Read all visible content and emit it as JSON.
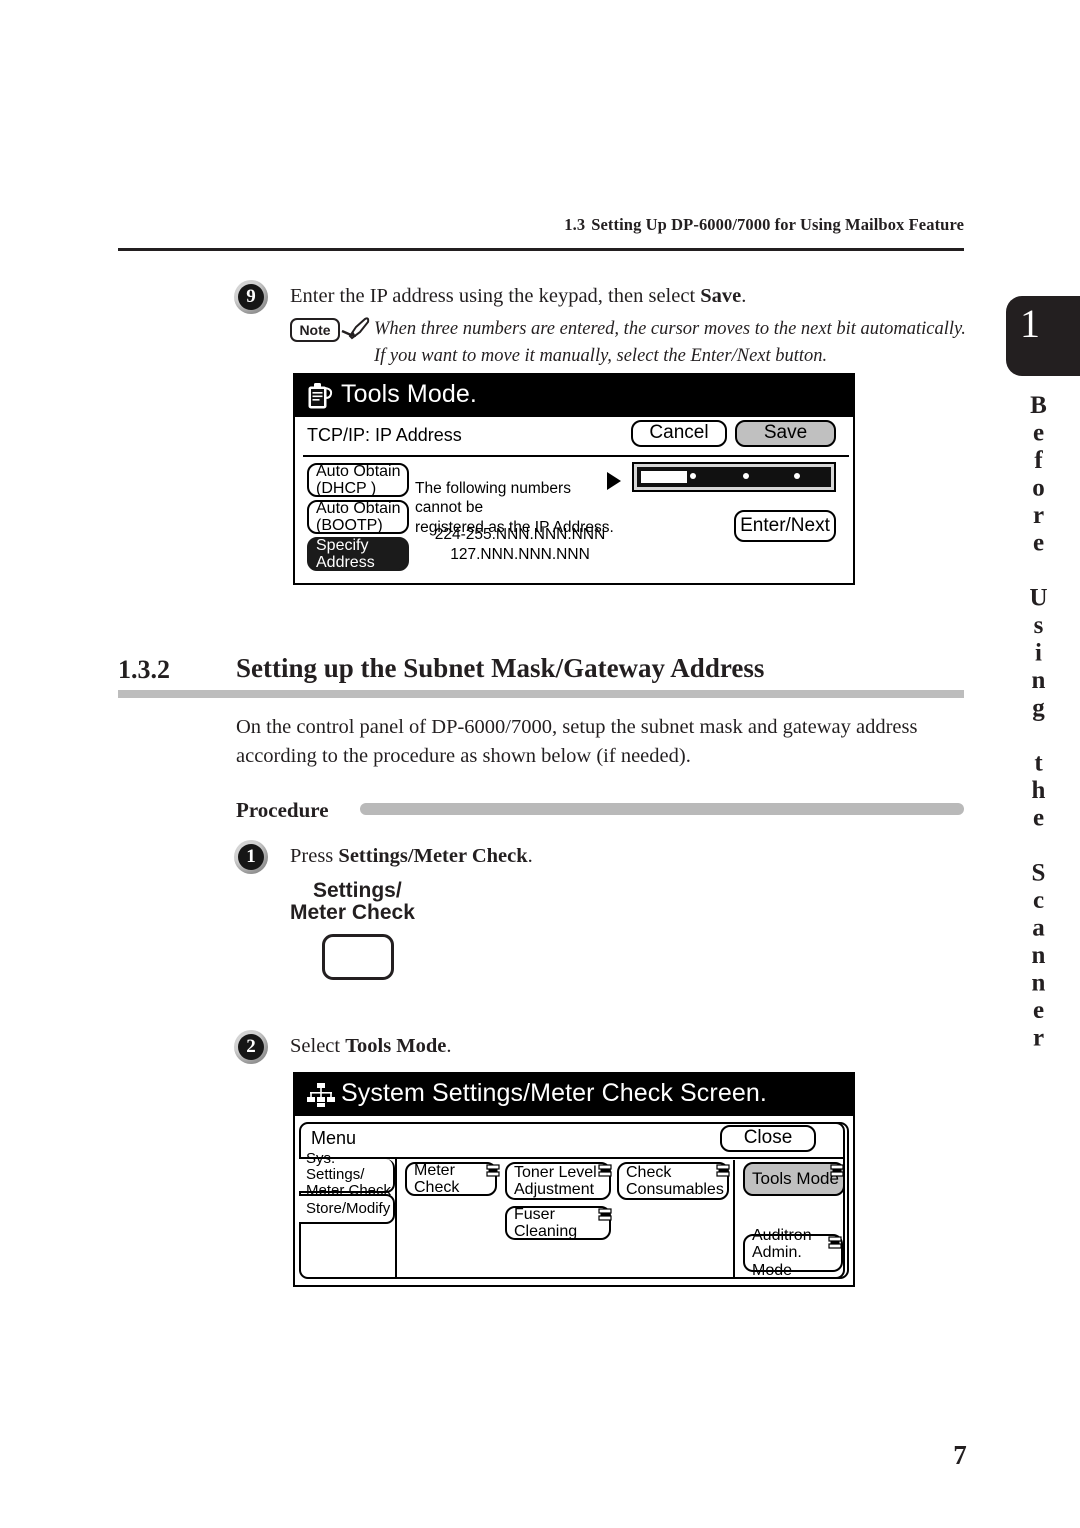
{
  "running_head": {
    "section": "1.3",
    "title": "Setting Up DP-6000/7000 for Using Mailbox Feature"
  },
  "thumb_tab": {
    "chapter_number": "1",
    "chapter_title": "Before Using the Scanner"
  },
  "step9": {
    "number": "9",
    "text_before": "Enter the IP address using the keypad, then select ",
    "bold": "Save",
    "text_after": "."
  },
  "note": {
    "badge": "Note",
    "line1": "When three numbers are entered, the cursor moves to the next bit automatically.",
    "line2": "If you want to move it manually, select the Enter/Next button."
  },
  "screen_tools_mode": {
    "title": "Tools Mode.",
    "title_icon": "tools-clipboard-icon",
    "subtitle": "TCP/IP: IP Address",
    "cancel_label": "Cancel",
    "save_label": "Save",
    "options": [
      {
        "line1": "Auto Obtain",
        "line2": "(DHCP    )",
        "selected": false
      },
      {
        "line1": "Auto Obtain",
        "line2": "(BOOTP)",
        "selected": false
      },
      {
        "line1": "Specify",
        "line2": "Address",
        "selected": true
      }
    ],
    "info_line1": "The following numbers cannot be",
    "info_line2": "registered as the IP Address.",
    "excluded1": "224-255.NNN.NNN.NNN",
    "excluded2": "127.NNN.NNN.NNN",
    "enter_next_label": "Enter/Next"
  },
  "section": {
    "number": "1.3.2",
    "title": "Setting up the Subnet Mask/Gateway Address",
    "body_line1": "On the control panel of DP-6000/7000, setup the subnet mask and gateway address",
    "body_line2": "according to the procedure as shown below (if needed).",
    "procedure_label": "Procedure"
  },
  "step1": {
    "number": "1",
    "text_before": "Press ",
    "bold": "Settings/Meter Check",
    "text_after": ".",
    "hw_label_line1": "Settings/",
    "hw_label_line2": "Meter Check"
  },
  "step2": {
    "number": "2",
    "text_before": "Select ",
    "bold": "Tools Mode",
    "text_after": "."
  },
  "screen_sys_settings": {
    "title": "System Settings/Meter Check Screen.",
    "title_icon": "hierarchy-icon",
    "menu_label": "Menu",
    "close_label": "Close",
    "left_tabs": [
      {
        "line1": "Sys. Settings/",
        "line2": "Meter Check",
        "active": true
      },
      {
        "line1": "Store/Modify",
        "line2": "",
        "active": false
      }
    ],
    "buttons": [
      {
        "line1": "Meter Check",
        "line2": "",
        "selected": false,
        "has_key": true
      },
      {
        "line1": "Toner Level",
        "line2": "Adjustment",
        "selected": false,
        "has_key": true
      },
      {
        "line1": "Check",
        "line2": "Consumables",
        "selected": false,
        "has_key": true
      },
      {
        "line1": "Fuser Cleaning",
        "line2": "",
        "selected": false,
        "has_key": true
      },
      {
        "line1": "Tools Mode",
        "line2": "",
        "selected": true,
        "has_key": true
      },
      {
        "line1": "Auditron",
        "line2": "Admin. Mode",
        "selected": false,
        "has_key": true
      }
    ]
  },
  "page_number": "7"
}
